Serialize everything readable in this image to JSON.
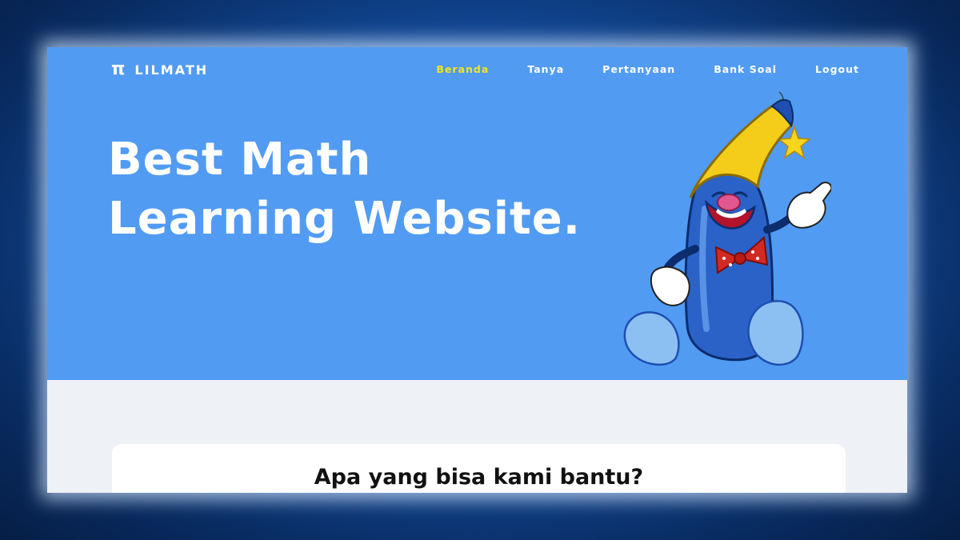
{
  "brand": {
    "logo_symbol": "π",
    "name": "LILMATH"
  },
  "nav": {
    "items": [
      {
        "label": "Beranda",
        "active": true
      },
      {
        "label": "Tanya",
        "active": false
      },
      {
        "label": "Pertanyaan",
        "active": false
      },
      {
        "label": "Bank Soal",
        "active": false
      },
      {
        "label": "Logout",
        "active": false
      }
    ]
  },
  "hero": {
    "headline_line1": "Best Math",
    "headline_line2": "Learning Website.",
    "illustration": "pencil-mascot-illustration"
  },
  "help_card": {
    "title": "Apa yang bisa kami bantu?"
  },
  "colors": {
    "hero_bg": "#519bf3",
    "nav_active": "#f4e41a",
    "nav_text": "#ffffff",
    "page_bg": "#eef1f6"
  }
}
